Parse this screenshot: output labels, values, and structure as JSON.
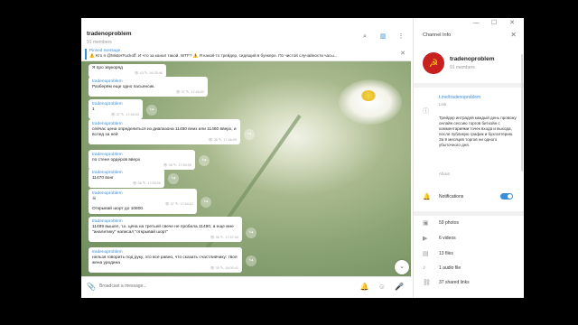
{
  "window_controls": [
    "—",
    "☐",
    "✕"
  ],
  "chat": {
    "title": "tradenoproblem",
    "subtitle": "91 members",
    "header_icons": [
      "search-icon",
      "sidebar-toggle-icon",
      "more-icon"
    ],
    "pinned": {
      "title": "Pinned message",
      "text": "⚠️ Кто я @MisterFuckoff. И что за канал такой. WTF? ⚠️ Я какой-то трейдер, сидящий в бункере. По чистой случайности часы..."
    },
    "messages": [
      {
        "author": "",
        "text": "Я про звукоряд",
        "meta": "👁 43  ✎, 16:25:46"
      },
      {
        "author": "tradenoproblem",
        "text": "Разберём еще одно пасьянсик.",
        "meta": "👁 37  ✎, 17:46:02"
      },
      {
        "author": "tradenoproblem",
        "text": "1",
        "meta": "👁 37  ✎, 17:46:03"
      },
      {
        "author": "tradenoproblem",
        "text": "сейчас цена определиться из диапазона 11450 вниз или 11460 вверх, и вслед за ней",
        "meta": "👁 36  ✎, 17:46:09"
      },
      {
        "author": "tradenoproblem",
        "text": "по стене ордеров вверх",
        "meta": "👁 36  ✎, 17:50:00"
      },
      {
        "author": "tradenoproblem",
        "text": "11470 вонг",
        "meta": "👁 36  ✎, 17:53:25"
      },
      {
        "author": "tradenoproblem",
        "text": "☠",
        "meta": "👁 37  ✎, 17:54:12"
      },
      {
        "author": "",
        "text": "Открывай шорт до 10800.",
        "meta": ""
      },
      {
        "author": "tradenoproblem",
        "text": "11489 вышел, т.к. цена на третьей свече не пробила 11490, а еще мне \"аналитику\" написал \"открывай шорт\"",
        "meta": "👁 36  ✎, 17:57:44"
      },
      {
        "author": "tradenoproblem",
        "text": "нельзя говорить под руку, это все равно, что сказать счастливчику: твоя жена уродина",
        "meta": "👁 35  ✎, 18:00:41"
      }
    ],
    "composer_placeholder": "Broadcast a message..."
  },
  "info": {
    "title": "Channel Info",
    "name": "tradenoproblem",
    "members": "91 members",
    "link": "t.me/tradenoproblem",
    "link_label": "Link",
    "about": "Трейдер интрадей каждый день провожу онлайн сессию торгов биткойн с комментариями точек входа и выхода, после публикую график и бухгалтерию. За 9 месяцев торгов ни одного убыточного дня.",
    "about_label": "About",
    "notifications_label": "Notifications",
    "notifications_on": true,
    "media": [
      {
        "icon": "photo-icon",
        "label": "59 photos"
      },
      {
        "icon": "video-icon",
        "label": "6 videos"
      },
      {
        "icon": "file-icon",
        "label": "13 files"
      },
      {
        "icon": "audio-icon",
        "label": "1 audio file"
      },
      {
        "icon": "link-icon",
        "label": "37 shared links"
      }
    ]
  },
  "colors": {
    "accent": "#3a8ed8",
    "avatar_bg": "#c81f1f",
    "avatar_fg": "#f5d000"
  }
}
